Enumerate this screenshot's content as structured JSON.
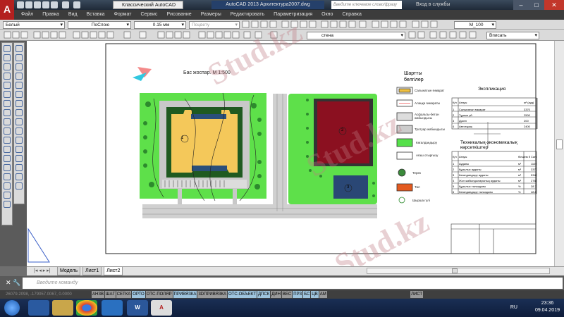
{
  "titlebar": {
    "workspace": "Классический AutoCAD",
    "title": "AutoCAD 2013   Архитектура2007.dwg",
    "search_placeholder": "Введите ключевое слово/фразу",
    "login": "Вход в службы"
  },
  "menu": [
    "Файл",
    "Правка",
    "Вид",
    "Вставка",
    "Формат",
    "Сервис",
    "Рисование",
    "Размеры",
    "Редактировать",
    "Параметризация",
    "Окно",
    "Справка"
  ],
  "toolbar": {
    "color": "Белый",
    "linetype": "ПоСлою",
    "lineweight": "0.15 мм",
    "plotstyle": "Поцвету",
    "dimstyle": "M_100",
    "layer": "стена",
    "viewport_scale": "Вписать"
  },
  "drawing": {
    "plan_title": "Бас жоспар.   М    1:500",
    "legend_title": "Шартты белгілер",
    "legend": [
      "Салынатын ғимарат",
      "Алаңқа ғимараты",
      "Асфальты-бетон жабындысы",
      "Тротуар жабындысы",
      "Көгалдандыру",
      "Ағаш отырғызу",
      "Терек",
      "Тал",
      "Шырша гүлі"
    ],
    "labels": [
      "1",
      "2",
      "3"
    ],
    "expl_title": "Экспликация",
    "expl_headers": [
      "Қ/п",
      "Атауы",
      "м² (ауд)"
    ],
    "expl_rows": [
      [
        "1",
        "Салынатын ғимарат",
        "3370"
      ],
      [
        "2",
        "Тұрғын үй",
        "2500"
      ],
      [
        "3",
        "Дүкен",
        "200"
      ],
      [
        "4",
        "Автотұрақ",
        "2400"
      ]
    ],
    "tech_title": "Техникалық-экономикалық көрсеткіштер",
    "tech_headers": [
      "Қ/п",
      "Атауы",
      "Өлшем бірлігі",
      "Саны"
    ],
    "tech_rows": [
      [
        "1",
        "Ауданы",
        "м²",
        "11081"
      ],
      [
        "2",
        "Құрылыс ауданы",
        "м²",
        "3370"
      ],
      [
        "3",
        "Көгалдандыру ауданы",
        "м²",
        "5346"
      ],
      [
        "4",
        "Жол жабындыларының ауданы",
        "м²",
        "2765"
      ],
      [
        "5",
        "Құрылыс тығыздығы",
        "%",
        "28.75"
      ],
      [
        "6",
        "Көгалдандыру тығыздығы",
        "%",
        "48.87"
      ]
    ],
    "watermark": "Stud.kz"
  },
  "tabs": [
    "Модель",
    "Лист1",
    "Лист2"
  ],
  "command": {
    "placeholder": "Введите команду"
  },
  "status": {
    "coords": "26079.2098, -179057.0067, 0.0000",
    "buttons": [
      {
        "l": "АНЗВ",
        "on": false
      },
      {
        "l": "ШАГ",
        "on": false
      },
      {
        "l": "СЕТКА",
        "on": false
      },
      {
        "l": "ОРТО",
        "on": true
      },
      {
        "l": "ОТС-ПОЛЯР",
        "on": false
      },
      {
        "l": "ПРИВЯЗКА",
        "on": true
      },
      {
        "l": "3DПРИВЯЗКА",
        "on": false
      },
      {
        "l": "ОТС-ОБЪЕКТ",
        "on": true
      },
      {
        "l": "ДПСК",
        "on": true
      },
      {
        "l": "ДИН",
        "on": false
      },
      {
        "l": "ВЕС",
        "on": false
      },
      {
        "l": "ПРЗ",
        "on": true
      },
      {
        "l": "БС",
        "on": true
      },
      {
        "l": "ЦВ",
        "on": true
      },
      {
        "l": "АМ",
        "on": false
      }
    ],
    "layout": "ЛИСТ"
  },
  "taskbar": {
    "lang": "RU",
    "time": "23:36",
    "date": "09.04.2019"
  }
}
